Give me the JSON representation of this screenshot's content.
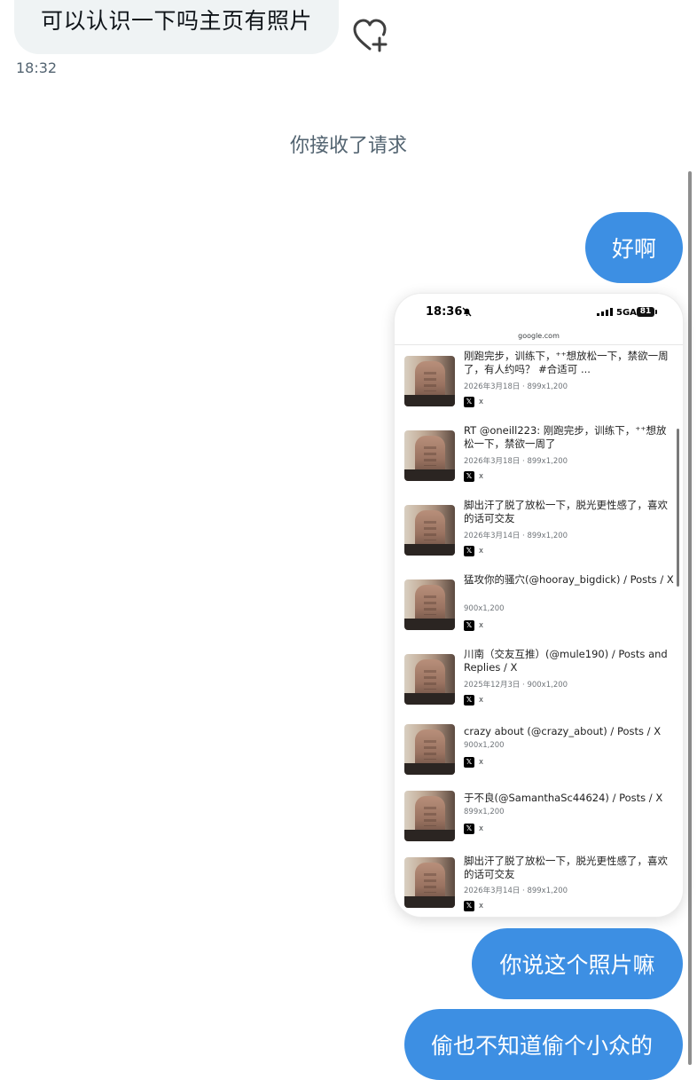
{
  "incoming_message": {
    "text": "可以认识一下吗主页有照片",
    "time": "18:32"
  },
  "system_notice": "你接收了请求",
  "outgoing_messages": [
    {
      "text": "好啊"
    },
    {
      "text": "你说这个照片嘛"
    },
    {
      "text": "偷也不知道偷个小众的"
    }
  ],
  "shared_screenshot": {
    "status_time": "18:36",
    "network": "5GA",
    "battery": "81",
    "url": "google.com",
    "results": [
      {
        "title": "刚跑完步，训练下，⁺⁺想放松一下，禁欲一周了，有人约吗？ #合适可 ...",
        "meta": "2026年3月18日 · 899x1,200",
        "source": "x"
      },
      {
        "title": "RT @oneill223: 刚跑完步，训练下，⁺⁺想放松一下，禁欲一周了",
        "meta": "2026年3月18日 · 899x1,200",
        "source": "x"
      },
      {
        "title": "脚出汗了脱了放松一下，脱光更性感了，喜欢的话可交友",
        "meta": "2026年3月14日 · 899x1,200",
        "source": "x"
      },
      {
        "title": "猛攻你的骚穴(@hooray_bigdick) / Posts / X",
        "meta": "900x1,200",
        "source": "x"
      },
      {
        "title": "川南（交友互推）(@mule190) / Posts and Replies / X",
        "meta": "2025年12月3日 · 900x1,200",
        "source": "x"
      },
      {
        "title": "crazy about (@crazy_about) / Posts / X",
        "meta": "900x1,200",
        "source": "x"
      },
      {
        "title": "于不良(@SamanthaSc44624) / Posts / X",
        "meta": "899x1,200",
        "source": "x"
      },
      {
        "title": "脚出汗了脱了放松一下，脱光更性感了，喜欢的话可交友",
        "meta": "2026年3月14日 · 899x1,200",
        "source": "x"
      }
    ]
  },
  "colors": {
    "outgoing_bubble": "#3d8fe3",
    "incoming_bubble": "#eff3f4",
    "secondary_text": "#536471"
  },
  "icons": {
    "reaction": "heart-plus-icon",
    "silent": "bell-slash-icon",
    "signal": "signal-bars-icon",
    "battery": "battery-icon",
    "source_logo": "x-logo-icon"
  }
}
